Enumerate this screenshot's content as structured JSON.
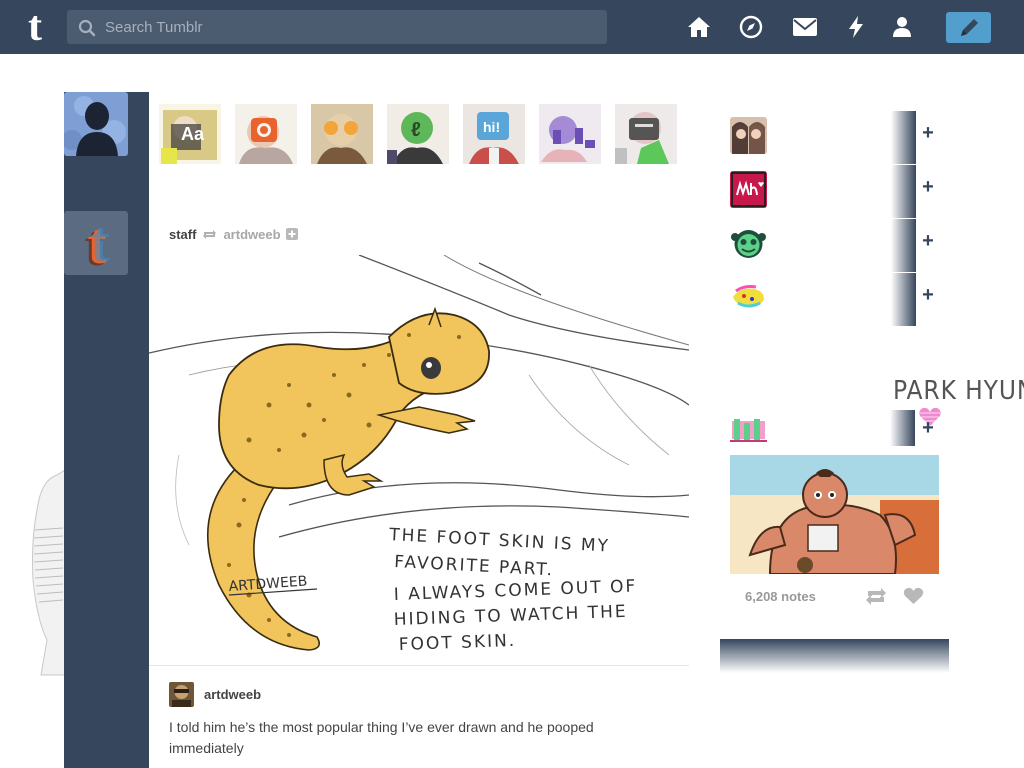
{
  "header": {
    "logo_letter": "t",
    "search_placeholder": "Search Tumblr",
    "icons": [
      "home-icon",
      "explore-icon",
      "inbox-icon",
      "activity-icon",
      "account-icon",
      "compose-icon"
    ]
  },
  "post": {
    "blog_name": "staff",
    "reblog_from": "artdweeb",
    "caption_author": "artdweeb",
    "caption": "I told him he’s the most popular thing I’ve ever drawn and he pooped immediately",
    "image_signature": "ARTDWEEB",
    "image_text_lines": [
      "THE FOOT SKIN IS MY",
      "FAVORITE PART.",
      "I ALWAYS COME OUT OF",
      "HIDING TO WATCH THE",
      "FOOT SKIN."
    ]
  },
  "sidebar": {
    "handwriting": "PARK HYUN",
    "notes": "6,208 notes"
  },
  "colors": {
    "navy": "#36465d",
    "accent": "#529ecc",
    "gecko": "#f2c55c"
  }
}
